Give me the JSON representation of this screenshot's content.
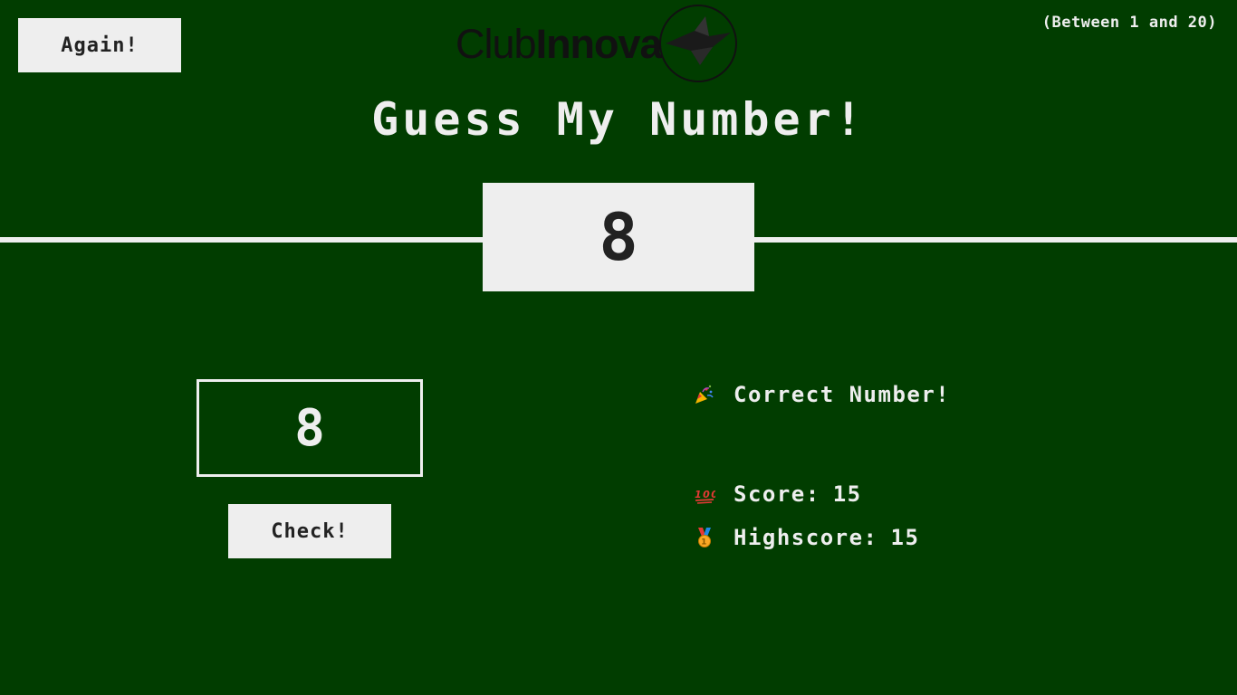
{
  "header": {
    "again_label": "Again!",
    "logo": {
      "text_light": "Club",
      "text_bold": "Innova"
    },
    "range_hint": "(Between 1 and 20)"
  },
  "title": "Guess My Number!",
  "secret_number": "8",
  "guess": {
    "value": "8"
  },
  "check_label": "Check!",
  "stats": {
    "message": "Correct Number!",
    "score_label": "Score:",
    "score_value": "15",
    "highscore_label": "Highscore:",
    "highscore_value": "15"
  },
  "icons": {
    "message": "party-popper-icon",
    "score": "hundred-points-icon",
    "highscore": "medal-icon"
  },
  "colors": {
    "background": "#013d00",
    "foreground": "#eeeeee",
    "dark_text": "#222222"
  }
}
